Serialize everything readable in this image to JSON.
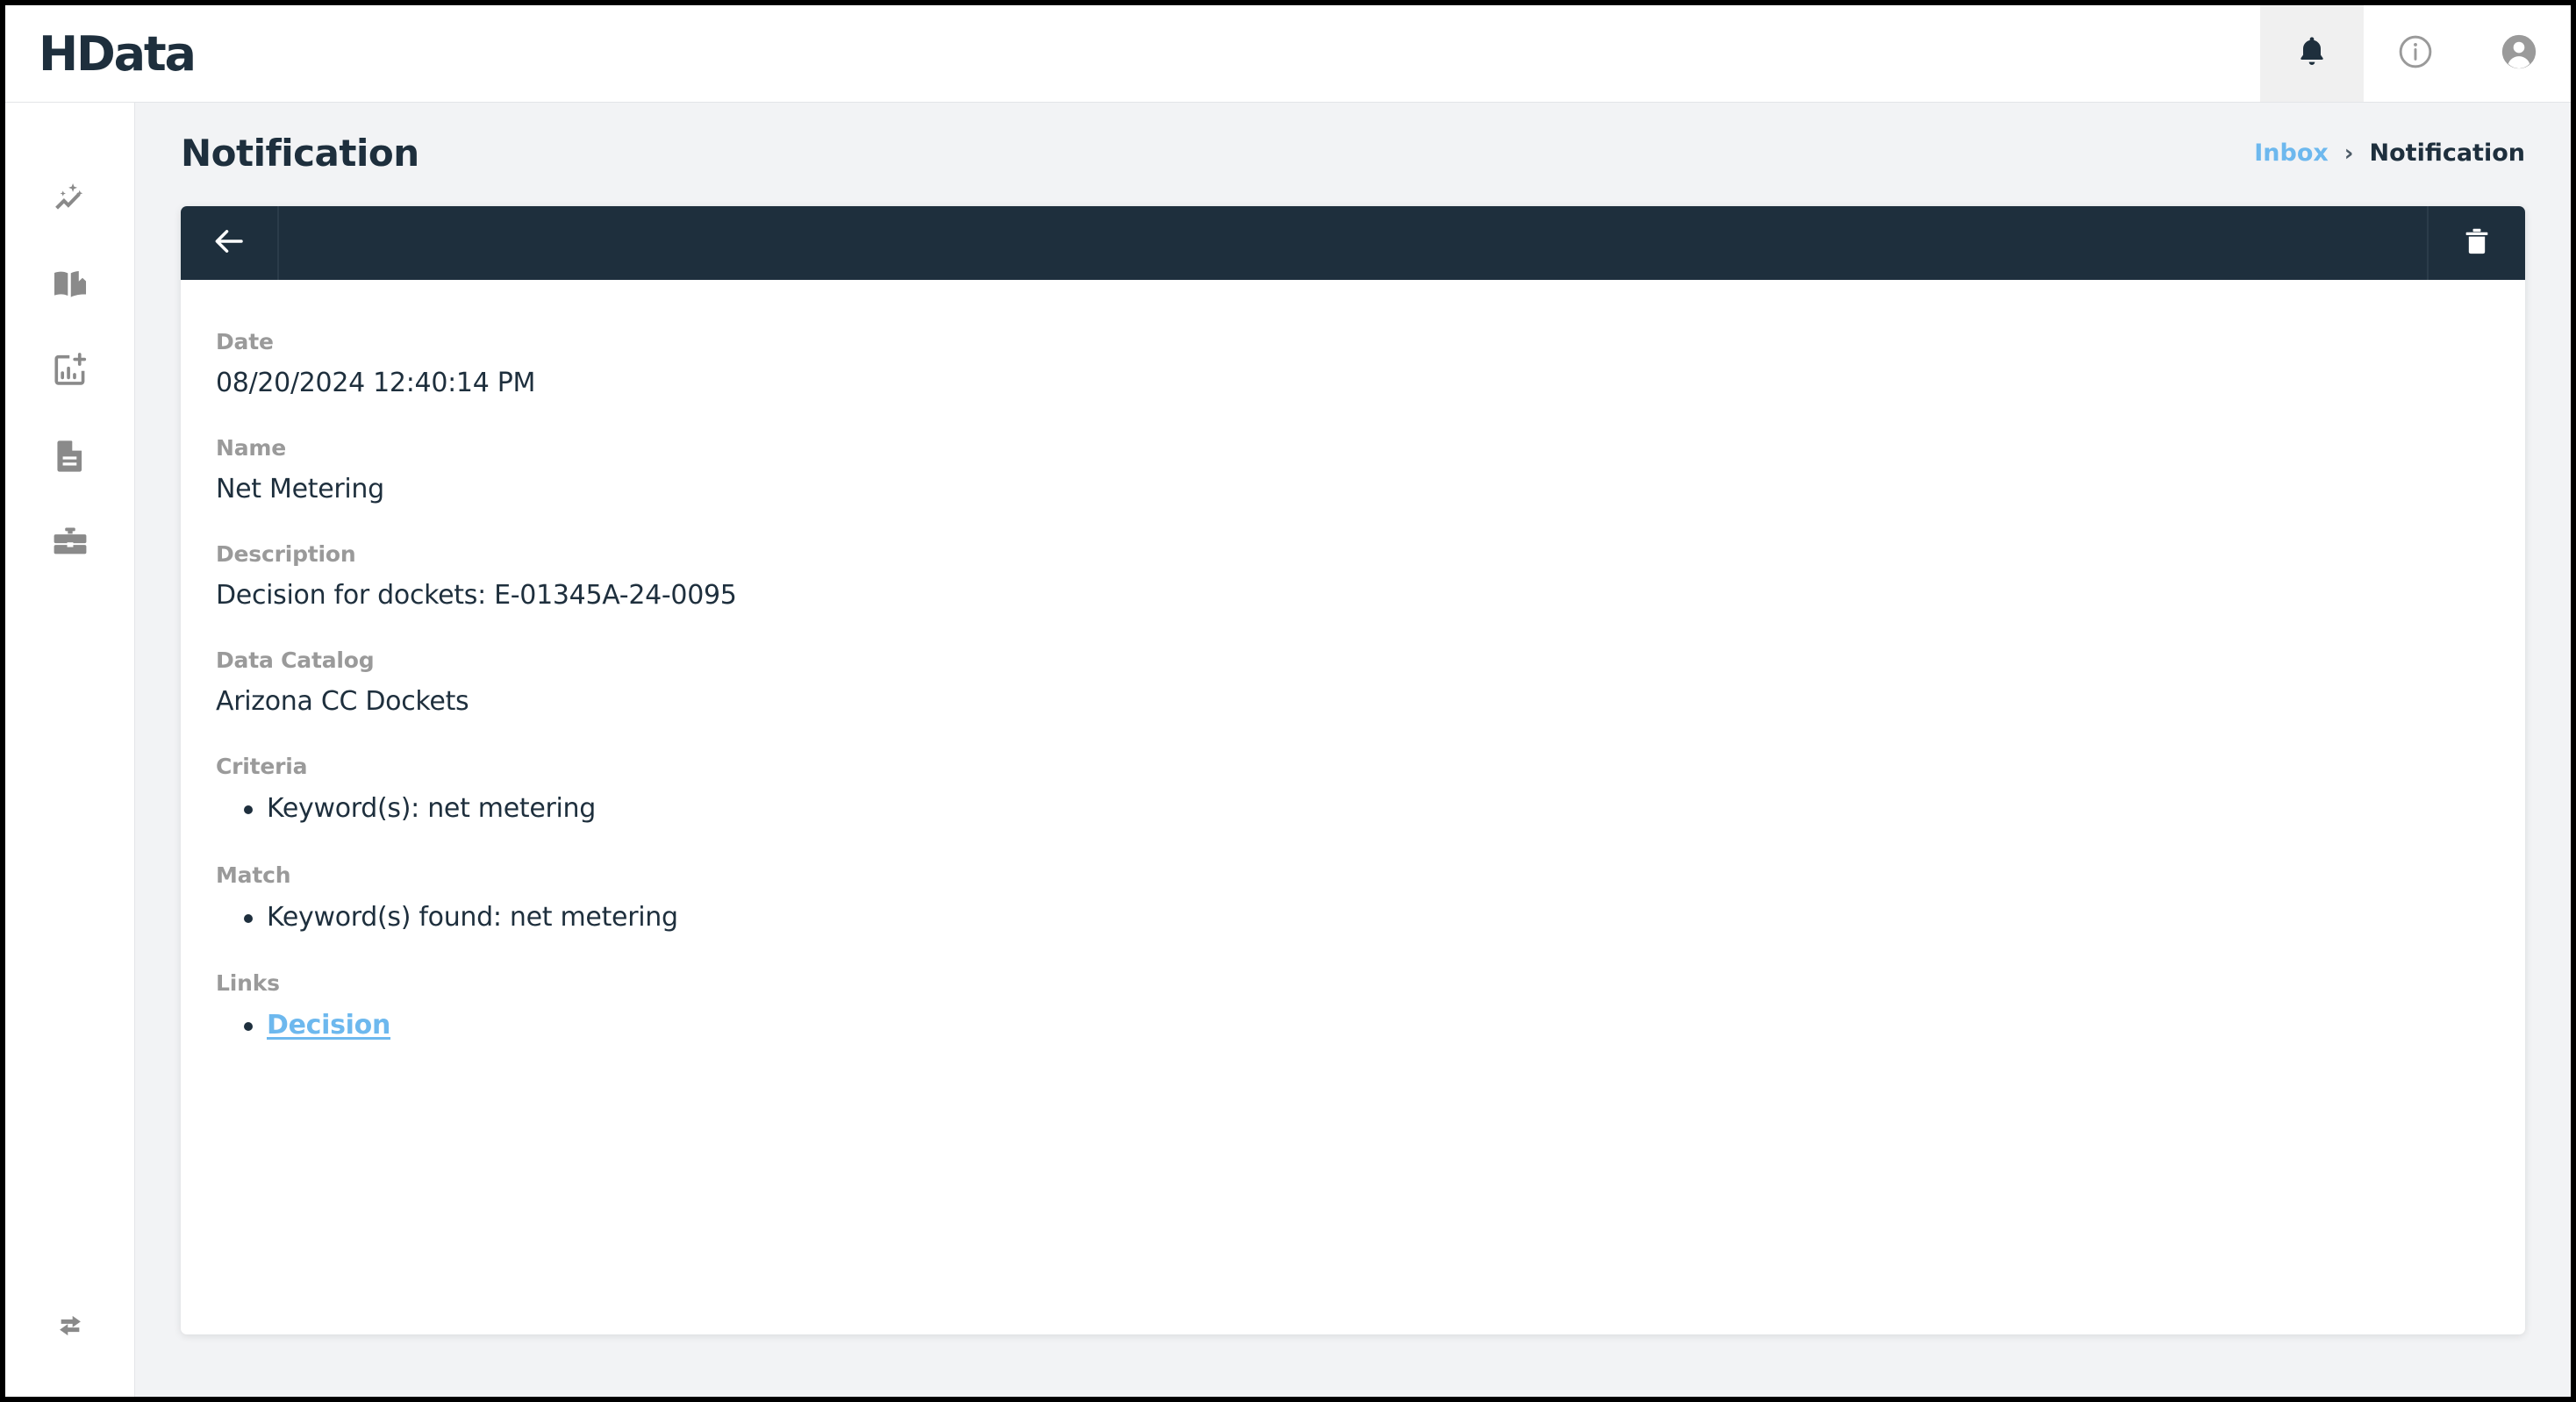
{
  "app": {
    "logo_text": "HData",
    "header_icons": [
      {
        "name": "notifications-icon",
        "label": "Notifications",
        "active": true
      },
      {
        "name": "info-icon",
        "label": "Information",
        "active": false
      },
      {
        "name": "account-icon",
        "label": "Account",
        "active": false
      }
    ]
  },
  "sidebar": {
    "items": [
      {
        "name": "insights-icon",
        "label": "Insights"
      },
      {
        "name": "library-icon",
        "label": "Library"
      },
      {
        "name": "new-report-icon",
        "label": "New Report"
      },
      {
        "name": "documents-icon",
        "label": "Documents"
      },
      {
        "name": "toolbox-icon",
        "label": "Toolbox"
      }
    ],
    "footer": {
      "name": "expand-collapse-icon",
      "label": "Expand / Collapse"
    }
  },
  "page": {
    "title": "Notification",
    "breadcrumb": {
      "parent": "Inbox",
      "separator": "›",
      "current": "Notification"
    }
  },
  "toolbar": {
    "back_label": "Back",
    "delete_label": "Delete"
  },
  "notification": {
    "date_label": "Date",
    "date_value": "08/20/2024 12:40:14 PM",
    "name_label": "Name",
    "name_value": "Net Metering",
    "description_label": "Description",
    "description_value": "Decision for dockets: E-01345A-24-0095",
    "catalog_label": "Data Catalog",
    "catalog_value": "Arizona CC Dockets",
    "criteria_label": "Criteria",
    "criteria_items": [
      "Keyword(s): net metering"
    ],
    "match_label": "Match",
    "match_items": [
      "Keyword(s) found: net metering"
    ],
    "links_label": "Links",
    "links_items": [
      "Decision"
    ]
  },
  "colors": {
    "brand_dark": "#1e2f3d",
    "link_blue": "#6db8ee",
    "muted_gray": "#9a9a9a",
    "page_bg": "#f2f3f5"
  }
}
